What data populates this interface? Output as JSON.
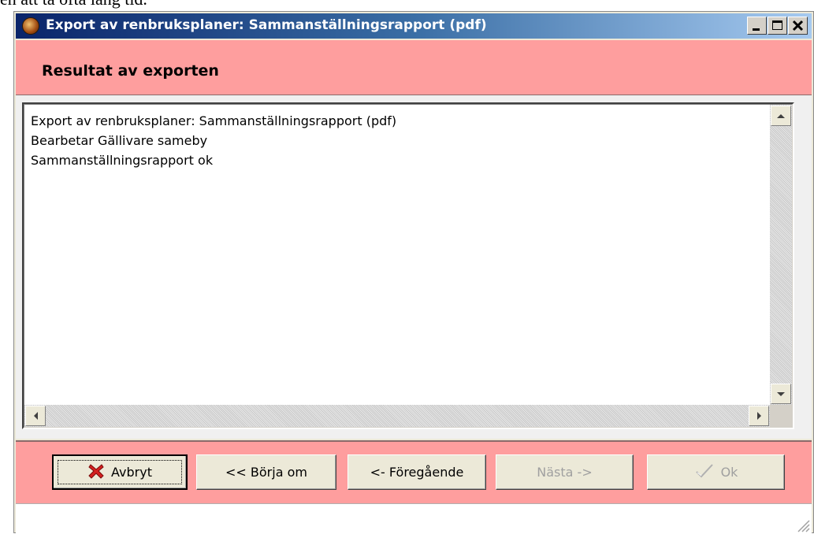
{
  "document": {
    "fragment_text": "en att ta ofta lång tid."
  },
  "window": {
    "title": "Export av renbruksplaner: Sammanställningsrapport (pdf)"
  },
  "header": {
    "title": "Resultat av exporten"
  },
  "log": {
    "lines": [
      "Export av renbruksplaner: Sammanställningsrapport (pdf)",
      "Bearbetar Gällivare sameby",
      "Sammanställningsrapport ok"
    ]
  },
  "buttons": {
    "cancel": {
      "label": "Avbryt",
      "icon": "red-x-icon",
      "enabled": true,
      "default": true
    },
    "restart": {
      "label": "<< Börja om",
      "enabled": true
    },
    "previous": {
      "label": "<- Föregående",
      "enabled": true
    },
    "next": {
      "label": "Nästa ->",
      "enabled": false
    },
    "ok": {
      "label": "Ok",
      "icon": "checkmark-icon",
      "enabled": false
    }
  },
  "colors": {
    "panel_accent": "#fe9e9e",
    "titlebar_start": "#0a246a",
    "titlebar_end": "#a6caf0",
    "cancel_icon": "#d42020"
  }
}
